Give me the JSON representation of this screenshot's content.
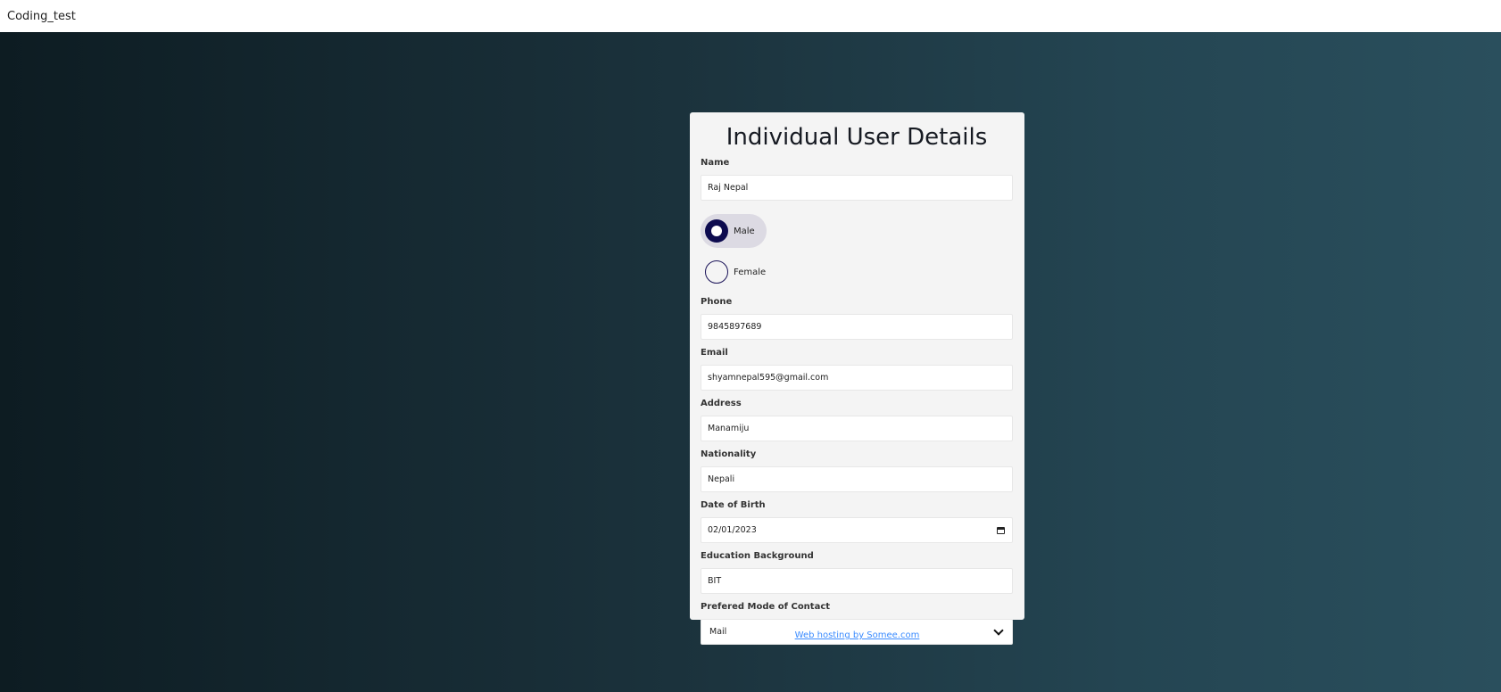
{
  "app": {
    "title": "Coding_test"
  },
  "form": {
    "title": "Individual User Details",
    "name": {
      "label": "Name",
      "value": "Raj Nepal"
    },
    "gender": {
      "options": [
        {
          "label": "Male",
          "selected": true
        },
        {
          "label": "Female",
          "selected": false
        }
      ]
    },
    "phone": {
      "label": "Phone",
      "value": "9845897689"
    },
    "email": {
      "label": "Email",
      "value": "shyamnepal595@gmail.com"
    },
    "address": {
      "label": "Address",
      "value": "Manamiju"
    },
    "nationality": {
      "label": "Nationality",
      "value": "Nepali"
    },
    "dob": {
      "label": "Date of Birth",
      "value": "02/01/2023"
    },
    "education": {
      "label": "Education Background",
      "value": "BIT"
    },
    "contact_mode": {
      "label": "Prefered Mode of Contact",
      "value": "Mail"
    }
  },
  "footer": {
    "link_text": "Web hosting by Somee.com"
  },
  "colors": {
    "radio_accent": "#0d0b4f",
    "link": "#3a8bff",
    "card_bg": "#f4f4f4"
  },
  "icons": {
    "calendar": "calendar-icon",
    "select": "chevron-down-icon"
  }
}
